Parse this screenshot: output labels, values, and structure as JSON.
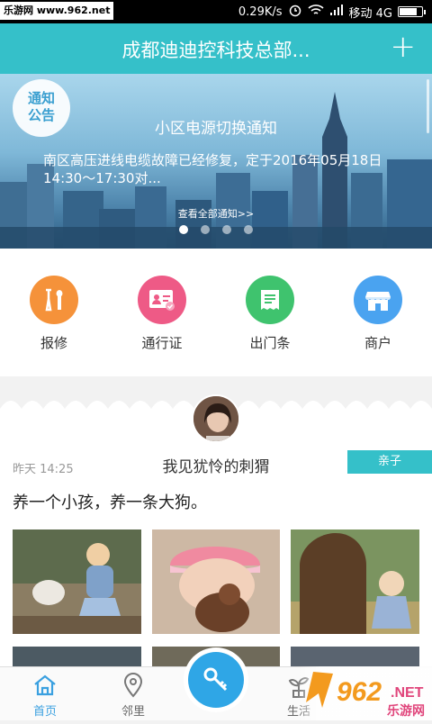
{
  "status_bar": {
    "watermark": "乐游网 www.962.net",
    "speed": "0.29K/s",
    "carrier": "移动 4G",
    "battery_level": 0.8
  },
  "header": {
    "title": "成都迪迪控科技总部...",
    "add_label": "+"
  },
  "banner": {
    "badge_line1": "通知",
    "badge_line2": "公告",
    "notice_title": "小区电源切换通知",
    "notice_body": "南区高压进线电缆故障已经修复，定于2016年05月18日14:30～17:30对...",
    "view_all": "查看全部通知>>",
    "pages": 4,
    "active_page": 0
  },
  "actions": [
    {
      "label": "报修",
      "icon": "repair-tools-icon",
      "color": "#f5923a"
    },
    {
      "label": "通行证",
      "icon": "pass-card-icon",
      "color": "#ee5a86"
    },
    {
      "label": "出门条",
      "icon": "exit-slip-icon",
      "color": "#3fc36e"
    },
    {
      "label": "商户",
      "icon": "store-icon",
      "color": "#4aa3f0"
    }
  ],
  "post": {
    "time": "昨天 14:25",
    "author": "我见犹怜的刺猬",
    "tag": "亲子",
    "text": "养一个小孩，养一条大狗。"
  },
  "bottom_nav": {
    "home": "首页",
    "neighbors": "邻里",
    "life": "生活",
    "center_icon": "key-icon"
  },
  "watermark_logo": {
    "brand": "962",
    "suffix": ".NET",
    "sub": "乐游网"
  }
}
